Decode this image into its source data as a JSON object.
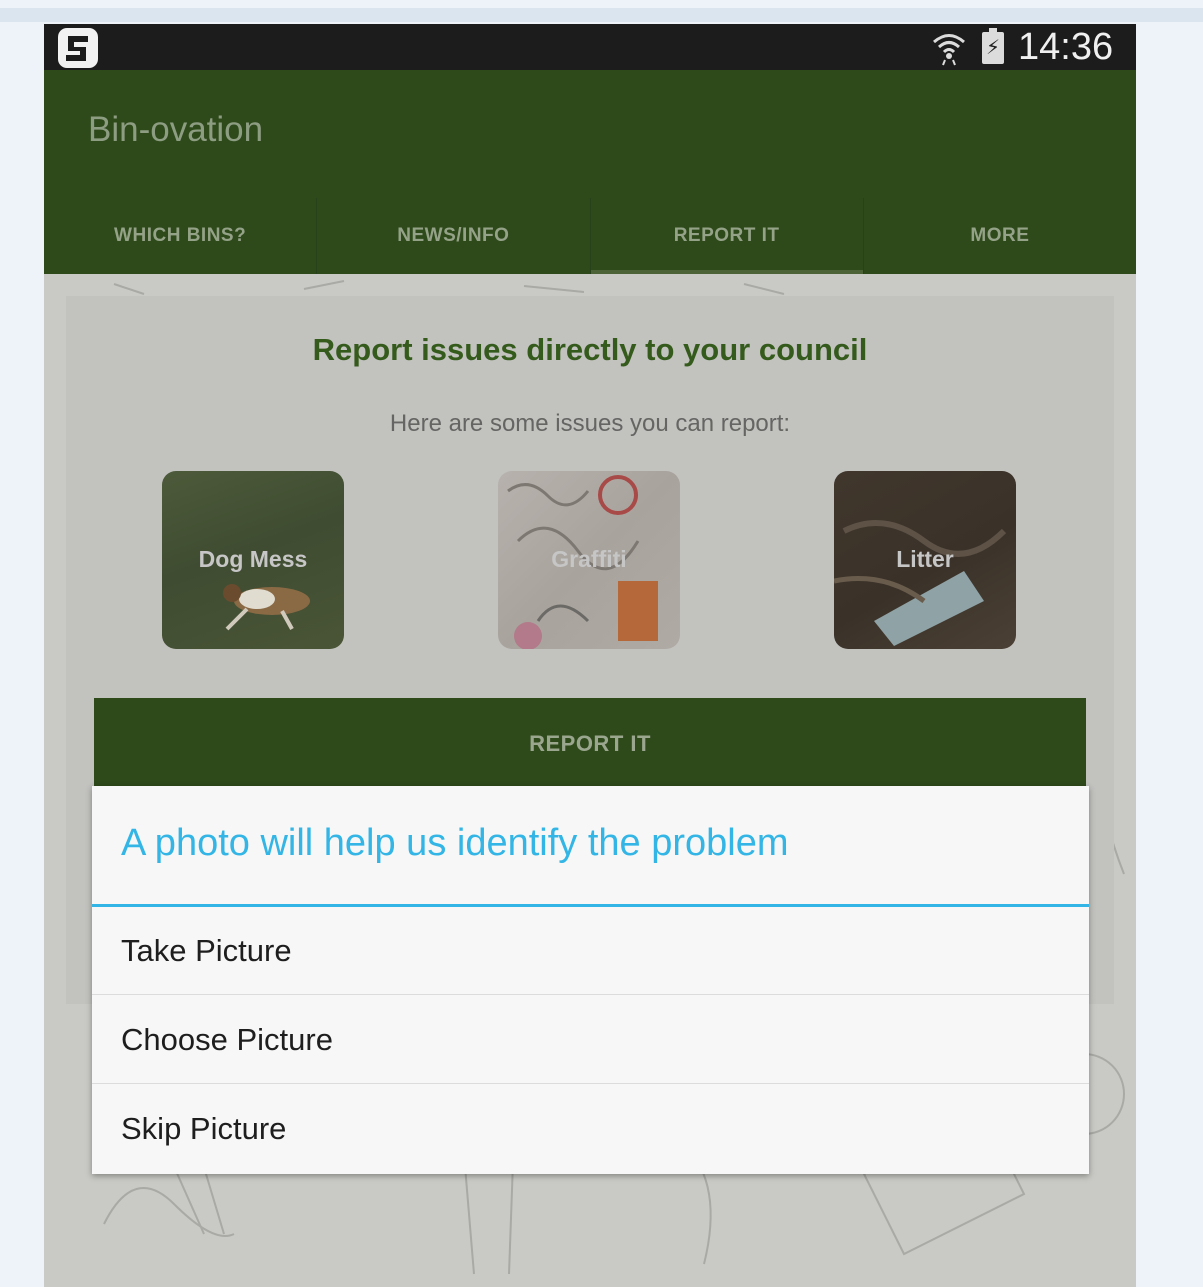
{
  "status_bar": {
    "time": "14:36",
    "battery_glyph": "⚡",
    "icons": [
      "app-logo-icon",
      "wifi-icon",
      "battery-charging-icon"
    ]
  },
  "app": {
    "title": "Bin-ovation"
  },
  "tabs": [
    {
      "label": "WHICH BINS?"
    },
    {
      "label": "NEWS/INFO"
    },
    {
      "label": "REPORT IT",
      "active": true
    },
    {
      "label": "MORE"
    }
  ],
  "report": {
    "heading": "Report issues directly to your council",
    "subheading": "Here are some issues you can report:",
    "issues": [
      {
        "label": "Dog Mess"
      },
      {
        "label": "Graffiti"
      },
      {
        "label": "Litter"
      }
    ],
    "button_label": "REPORT IT"
  },
  "dialog": {
    "title": "A photo will help us identify the problem",
    "options": [
      {
        "label": "Take Picture"
      },
      {
        "label": "Choose Picture"
      },
      {
        "label": "Skip Picture"
      }
    ]
  },
  "colors": {
    "app_bar": "#2e4a1b",
    "accent_blue": "#33b5e5",
    "heading_green": "#355b1c"
  }
}
